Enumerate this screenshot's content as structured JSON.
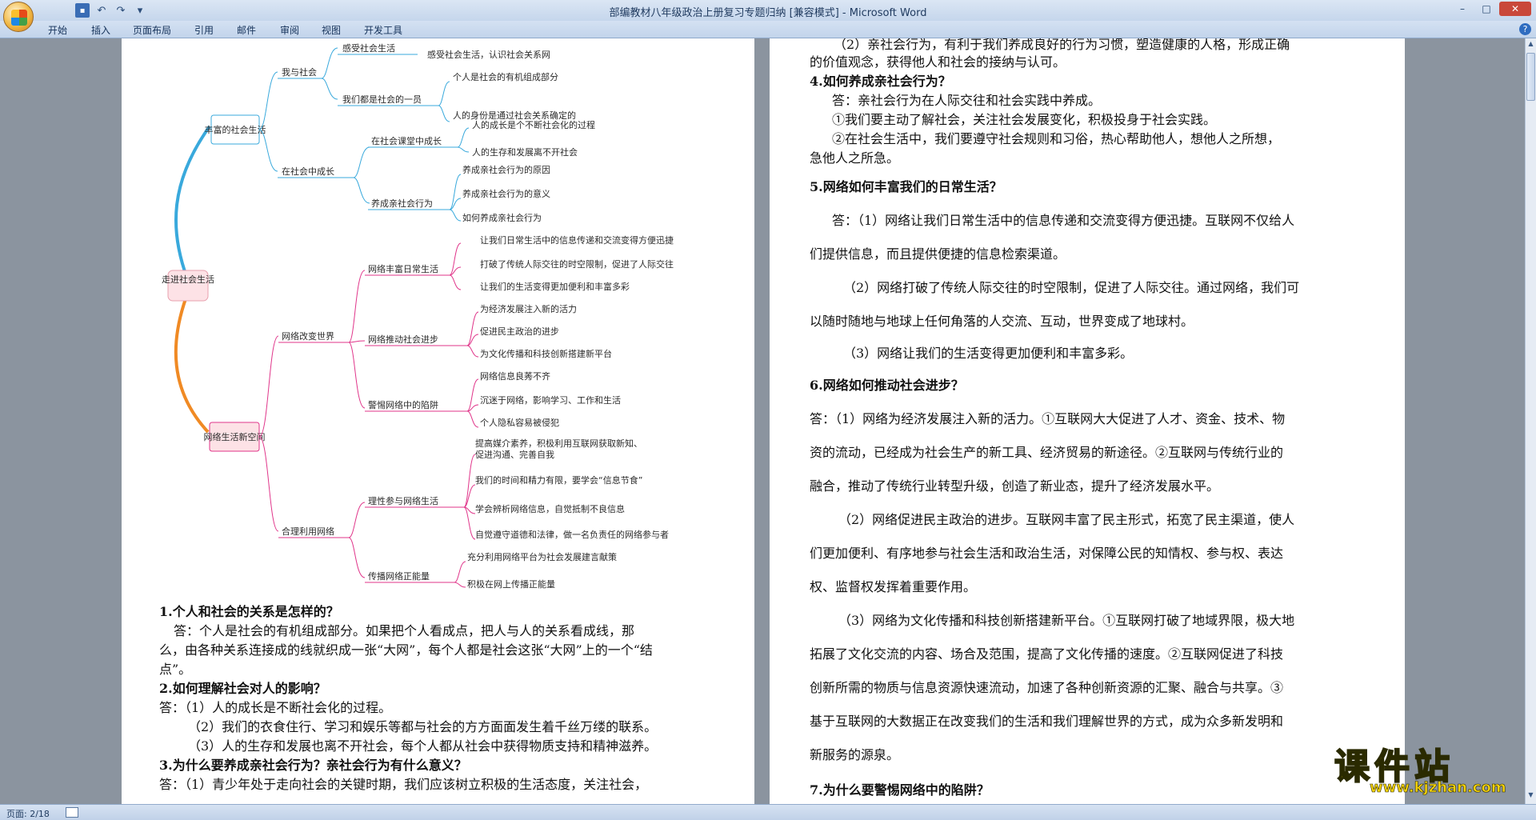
{
  "window": {
    "title": "部编教材八年级政治上册复习专题归纳 [兼容模式] - Microsoft Word"
  },
  "menu": {
    "tabs": [
      "开始",
      "插入",
      "页面布局",
      "引用",
      "邮件",
      "审阅",
      "视图",
      "开发工具"
    ]
  },
  "statusbar": {
    "page": "页面: 2/18"
  },
  "mindmap": {
    "root": "走进社会生活",
    "branch1": "丰富的社会生活",
    "branch2": "网络生活新空间",
    "b1_sub1": "我与社会",
    "b1_sub2": "在社会中成长",
    "b2_sub1": "网络改变世界",
    "b2_sub2": "合理利用网络",
    "n_1": "感受社会生活",
    "n_1a": "感受社会生活，认识社会关系网",
    "n_2": "我们都是社会的一员",
    "n_2a": "个人是社会的有机组成部分",
    "n_2b": "人的身份是通过社会关系确定的",
    "n_3": "在社会课堂中成长",
    "n_3a": "人的成长是个不断社会化的过程",
    "n_3b": "人的生存和发展离不开社会",
    "n_4": "养成亲社会行为",
    "n_4a": "养成亲社会行为的原因",
    "n_4b": "养成亲社会行为的意义",
    "n_4c": "如何养成亲社会行为",
    "n_5": "网络丰富日常生活",
    "n_5a": "让我们日常生活中的信息传递和交流变得方便迅捷",
    "n_5b": "打破了传统人际交往的时空限制，促进了人际交往",
    "n_5c": "让我们的生活变得更加便利和丰富多彩",
    "n_6": "网络推动社会进步",
    "n_6a": "为经济发展注入新的活力",
    "n_6b": "促进民主政治的进步",
    "n_6c": "为文化传播和科技创新搭建新平台",
    "n_7": "警惕网络中的陷阱",
    "n_7a": "网络信息良莠不齐",
    "n_7b": "沉迷于网络，影响学习、工作和生活",
    "n_7c": "个人隐私容易被侵犯",
    "n_8": "理性参与网络生活",
    "n_8a1": "提高媒介素养，积极利用互联网获取新知、",
    "n_8a2": "促进沟通、完善自我",
    "n_8b": "我们的时间和精力有限，要学会“信息节食”",
    "n_8c": "学会辨析网络信息，自觉抵制不良信息",
    "n_8d": "自觉遵守道德和法律，做一名负责任的网络参与者",
    "n_9": "传播网络正能量",
    "n_9a": "充分利用网络平台为社会发展建言献策",
    "n_9b": "积极在网上传播正能量"
  },
  "left_text": [
    "1.个人和社会的关系是怎样的？",
    "答：个人是社会的有机组成部分。如果把个人看成点，把人与人的关系看成线，那",
    "么，由各种关系连接成的线就织成一张“大网”，每个人都是社会这张“大网”上的一个“结",
    "点”。",
    "2.如何理解社会对人的影响？",
    "答：（1）人的成长是不断社会化的过程。",
    "（2）我们的衣食住行、学习和娱乐等都与社会的方方面面发生着千丝万缕的联系。",
    "（3）人的生存和发展也离不开社会，每个人都从社会中获得物质支持和精神滋养。",
    "3.为什么要养成亲社会行为？亲社会行为有什么意义？",
    "答：（1）青少年处于走向社会的关键时期，我们应该树立积极的生活态度，关注社会，"
  ],
  "right_text": [
    "（2）亲社会行为，有利于我们养成良好的行为习惯，塑造健康的人格，形成正确",
    "的价值观念，获得他人和社会的接纳与认可。",
    "4.如何养成亲社会行为？",
    "答：亲社会行为在人际交往和社会实践中养成。",
    "①我们要主动了解社会，关注社会发展变化，积极投身于社会实践。",
    "②在社会生活中，我们要遵守社会规则和习俗，热心帮助他人，想他人之所想，",
    "急他人之所急。",
    "5.网络如何丰富我们的日常生活？",
    "答：（1）网络让我们日常生活中的信息传递和交流变得方便迅捷。互联网不仅给人",
    "们提供信息，而且提供便捷的信息检索渠道。",
    "（2）网络打破了传统人际交往的时空限制，促进了人际交往。通过网络，我们可",
    "以随时随地与地球上任何角落的人交流、互动，世界变成了地球村。",
    "（3）网络让我们的生活变得更加便利和丰富多彩。",
    "6.网络如何推动社会进步？",
    "答：（1）网络为经济发展注入新的活力。①互联网大大促进了人才、资金、技术、物",
    "资的流动，已经成为社会生产的新工具、经济贸易的新途径。②互联网与传统行业的",
    "融合，推动了传统行业转型升级，创造了新业态，提升了经济发展水平。",
    "（2）网络促进民主政治的进步。互联网丰富了民主形式，拓宽了民主渠道，使人",
    "们更加便利、有序地参与社会生活和政治生活，对保障公民的知情权、参与权、表达",
    "权、监督权发挥着重要作用。",
    "（3）网络为文化传播和科技创新搭建新平台。①互联网打破了地域界限，极大地",
    "拓展了文化交流的内容、场合及范围，提高了文化传播的速度。②互联网促进了科技",
    "创新所需的物质与信息资源快速流动，加速了各种创新资源的汇聚、融合与共享。③",
    "基于互联网的大数据正在改变我们的生活和我们理解世界的方式，成为众多新发明和",
    "新服务的源泉。",
    "7.为什么要警惕网络中的陷阱？"
  ],
  "watermark": {
    "brand": "课件站",
    "site": "www.kjzhan.com"
  },
  "colors": {
    "blue_branch": "#39a9dc",
    "orange_branch": "#f08a24",
    "pink_branch": "#e0358a",
    "root_fill": "#fde2e6"
  }
}
